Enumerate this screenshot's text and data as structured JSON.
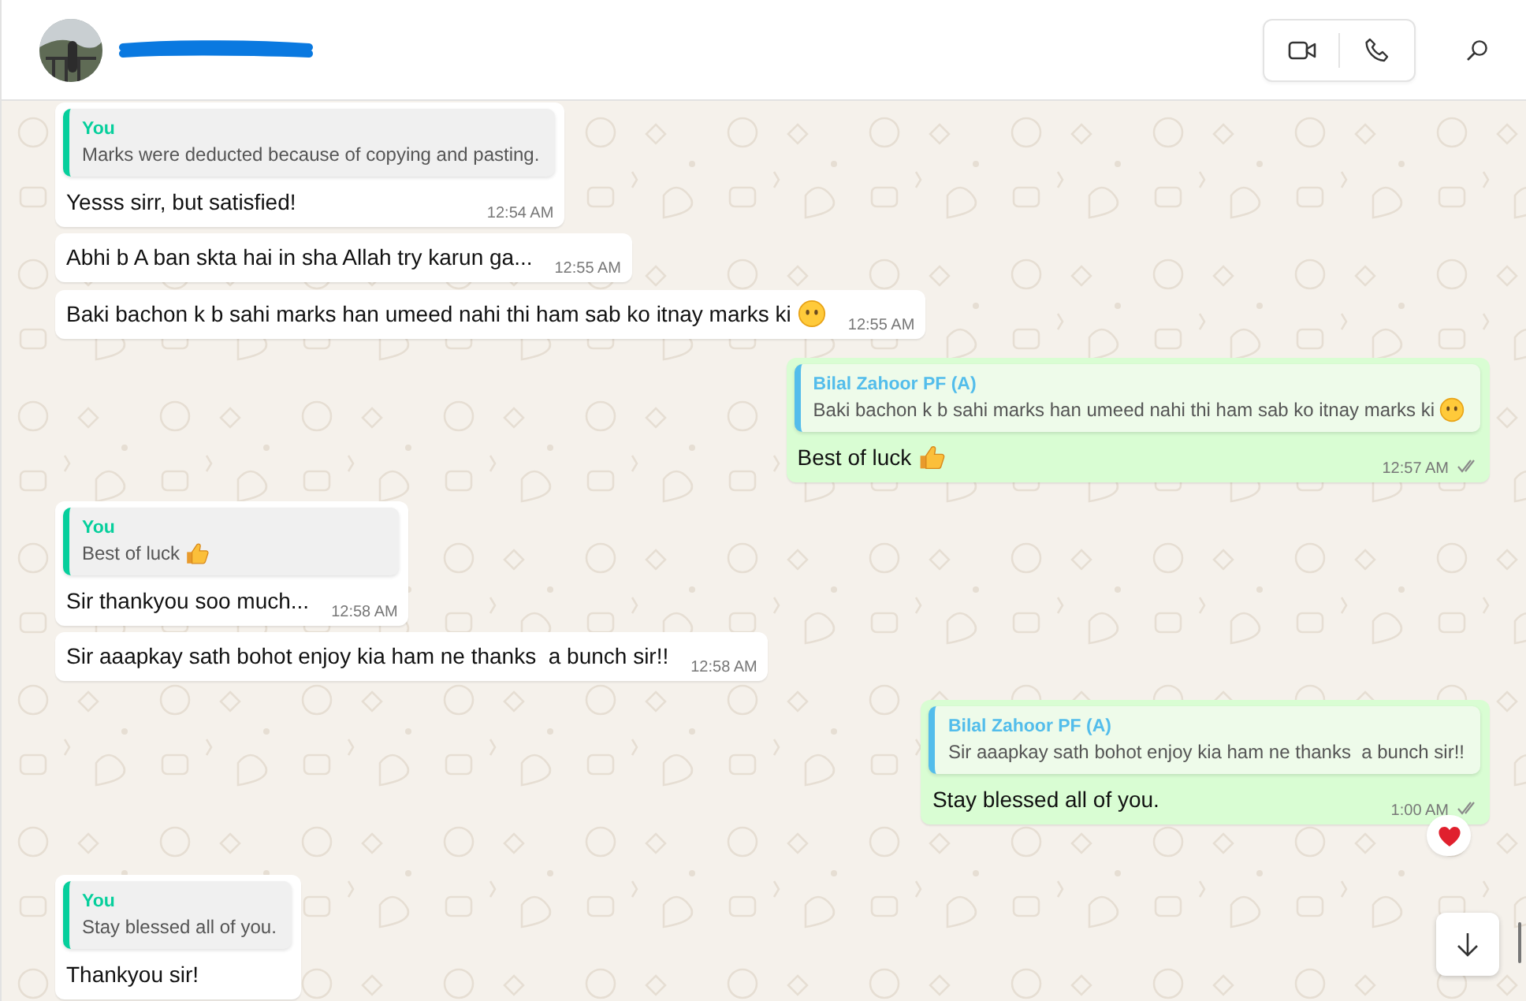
{
  "messages": [
    {
      "kind": "incoming",
      "quote": {
        "author": "You",
        "color": "#06cf9c",
        "text": "Marks were deducted because of copying and pasting."
      },
      "text": "Yesss sirr, but satisfied!",
      "time": "12:54 AM"
    },
    {
      "kind": "incoming",
      "text": "Abhi b A ban skta hai in sha Allah try karun ga...",
      "time": "12:55 AM"
    },
    {
      "kind": "incoming",
      "text": "Baki bachon k b sahi marks han umeed nahi thi ham sab ko itnay marks ki",
      "emoji": {
        "kind": "face"
      },
      "time": "12:55 AM"
    },
    {
      "kind": "outgoing",
      "quote": {
        "author": "Bilal Zahoor PF (A)",
        "color": "#53bdeb",
        "text": "Baki bachon k b sahi marks han umeed nahi thi ham sab ko itnay marks ki",
        "emoji": {
          "kind": "face"
        }
      },
      "text": "Best of luck",
      "emoji": {
        "kind": "thumbs"
      },
      "time": "12:57 AM",
      "read": false
    },
    {
      "kind": "incoming",
      "quote": {
        "author": "You",
        "color": "#06cf9c",
        "text": "Best of luck",
        "emoji": {
          "kind": "thumbs"
        }
      },
      "text": "Sir thankyou soo much...",
      "time": "12:58 AM"
    },
    {
      "kind": "incoming",
      "text": "Sir aaapkay sath bohot enjoy kia ham ne thanks  a bunch sir!!",
      "time": "12:58 AM"
    },
    {
      "kind": "outgoing",
      "quote": {
        "author": "Bilal Zahoor PF (A)",
        "color": "#53bdeb",
        "text": "Sir aaapkay sath bohot enjoy kia ham ne thanks  a bunch sir!!"
      },
      "text": "Stay blessed all of you.",
      "time": "1:00 AM",
      "read": false,
      "reaction": {
        "kind": "heart"
      }
    },
    {
      "kind": "incoming",
      "quote": {
        "author": "You",
        "color": "#06cf9c",
        "text": "Stay blessed all of you."
      },
      "text": "Thankyou sir!"
    }
  ]
}
